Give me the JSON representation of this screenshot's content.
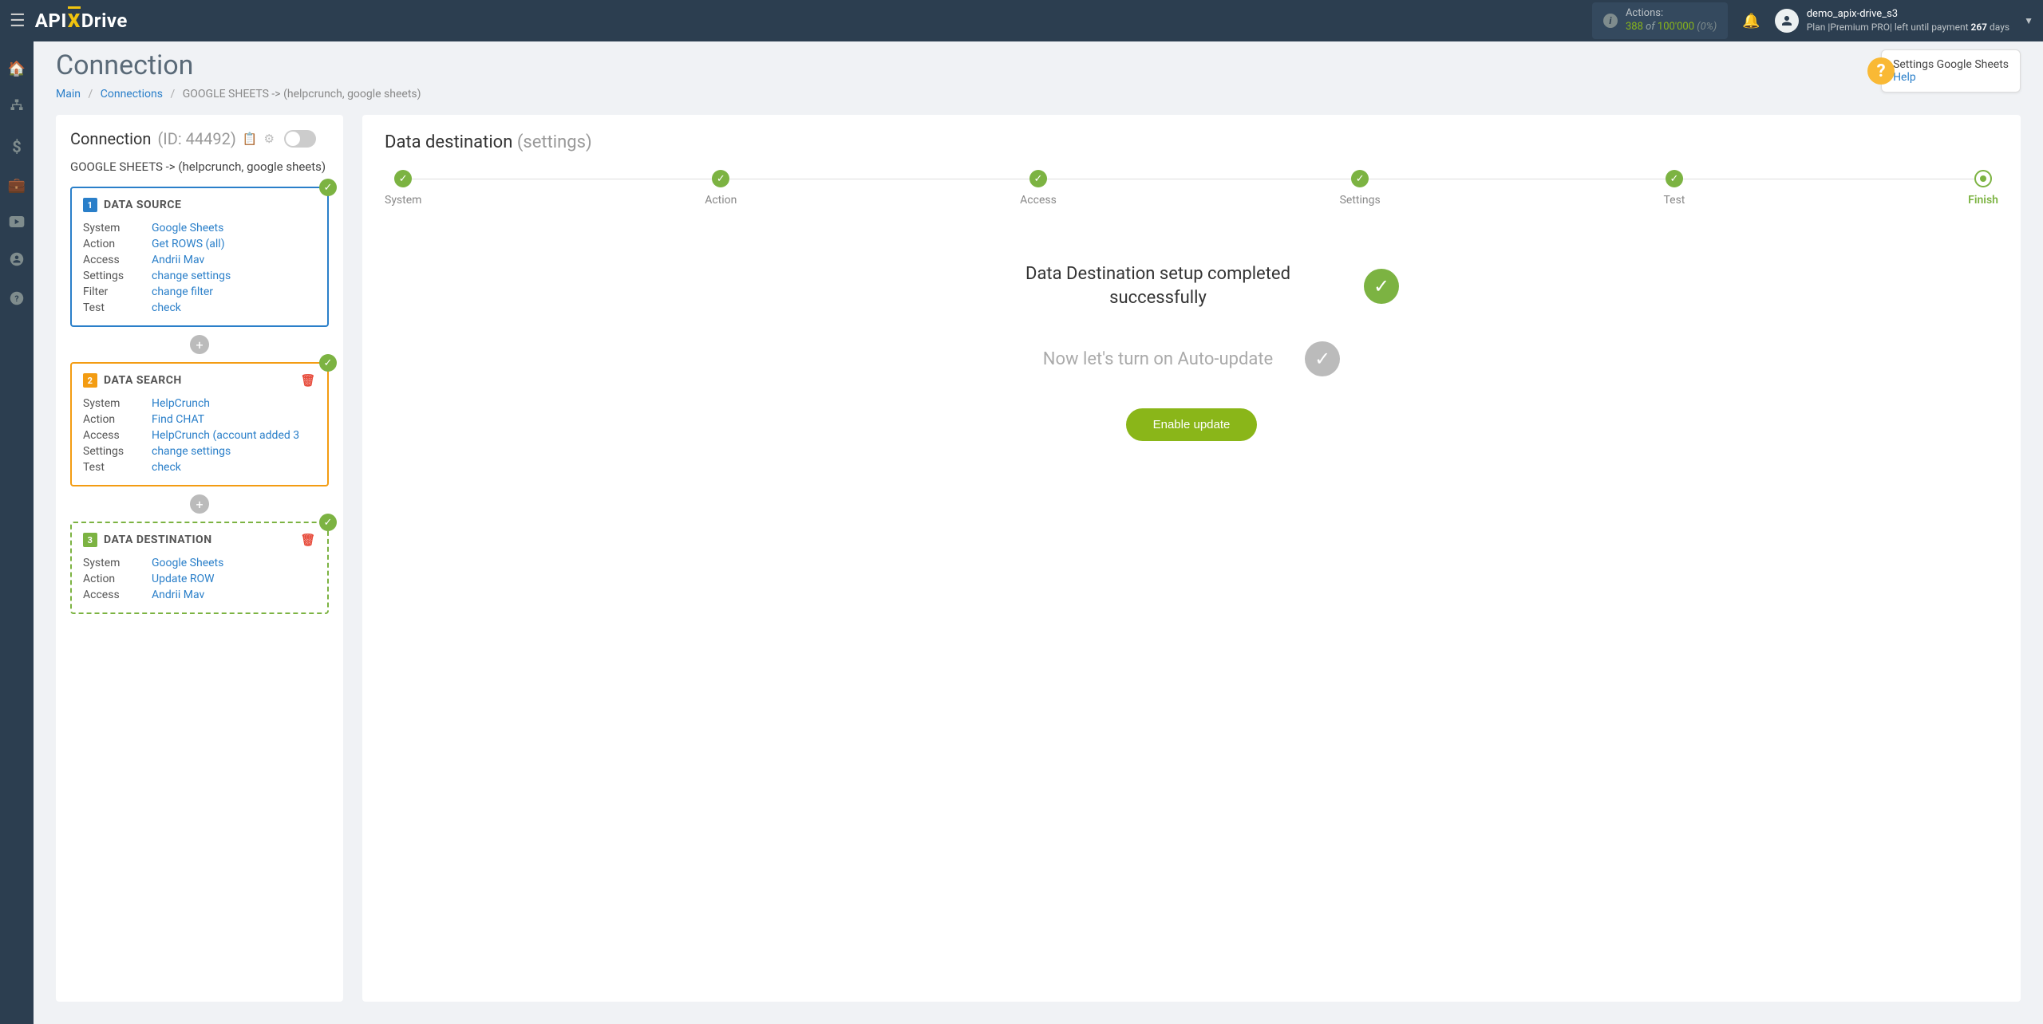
{
  "header": {
    "logo_pre": "API",
    "logo_x": "X",
    "logo_post": "Drive",
    "actions": {
      "label": "Actions:",
      "used": "388",
      "of": "of",
      "limit": "100'000",
      "pct": "(0%)"
    },
    "user": {
      "name": "demo_apix-drive_s3",
      "plan_pre": "Plan |",
      "plan_name": "Premium PRO",
      "plan_mid": "| left until payment ",
      "plan_days": "267",
      "plan_post": " days"
    }
  },
  "leftrail": [
    "home",
    "sitemap",
    "dollar",
    "briefcase",
    "youtube",
    "user",
    "question"
  ],
  "page": {
    "title": "Connection",
    "breadcrumb": {
      "main": "Main",
      "connections": "Connections",
      "current": "GOOGLE SHEETS -> (helpcrunch, google sheets)"
    },
    "help": {
      "title": "Settings Google Sheets",
      "link": "Help"
    }
  },
  "left": {
    "conn_label": "Connection",
    "conn_id": "(ID: 44492)",
    "conn_path": "GOOGLE SHEETS -> (helpcrunch, google sheets)",
    "blocks": [
      {
        "color": "blue",
        "num": "1",
        "title": "DATA SOURCE",
        "trash": false,
        "rows": [
          {
            "k": "System",
            "v": "Google Sheets"
          },
          {
            "k": "Action",
            "v": "Get ROWS (all)"
          },
          {
            "k": "Access",
            "v": "Andrii Mav"
          },
          {
            "k": "Settings",
            "v": "change settings"
          },
          {
            "k": "Filter",
            "v": "change filter"
          },
          {
            "k": "Test",
            "v": "check"
          }
        ]
      },
      {
        "color": "orange",
        "num": "2",
        "title": "DATA SEARCH",
        "trash": true,
        "rows": [
          {
            "k": "System",
            "v": "HelpCrunch"
          },
          {
            "k": "Action",
            "v": "Find CHAT"
          },
          {
            "k": "Access",
            "v": "HelpCrunch (account added 3"
          },
          {
            "k": "Settings",
            "v": "change settings"
          },
          {
            "k": "Test",
            "v": "check"
          }
        ]
      },
      {
        "color": "green",
        "num": "3",
        "title": "DATA DESTINATION",
        "trash": true,
        "rows": [
          {
            "k": "System",
            "v": "Google Sheets"
          },
          {
            "k": "Action",
            "v": "Update ROW"
          },
          {
            "k": "Access",
            "v": "Andrii Mav"
          }
        ]
      }
    ]
  },
  "right": {
    "title": "Data destination",
    "title_sub": "(settings)",
    "steps": [
      "System",
      "Action",
      "Access",
      "Settings",
      "Test",
      "Finish"
    ],
    "active_step": 5,
    "msg1": "Data Destination setup completed successfully",
    "msg2": "Now let's turn on Auto-update",
    "button": "Enable update"
  }
}
